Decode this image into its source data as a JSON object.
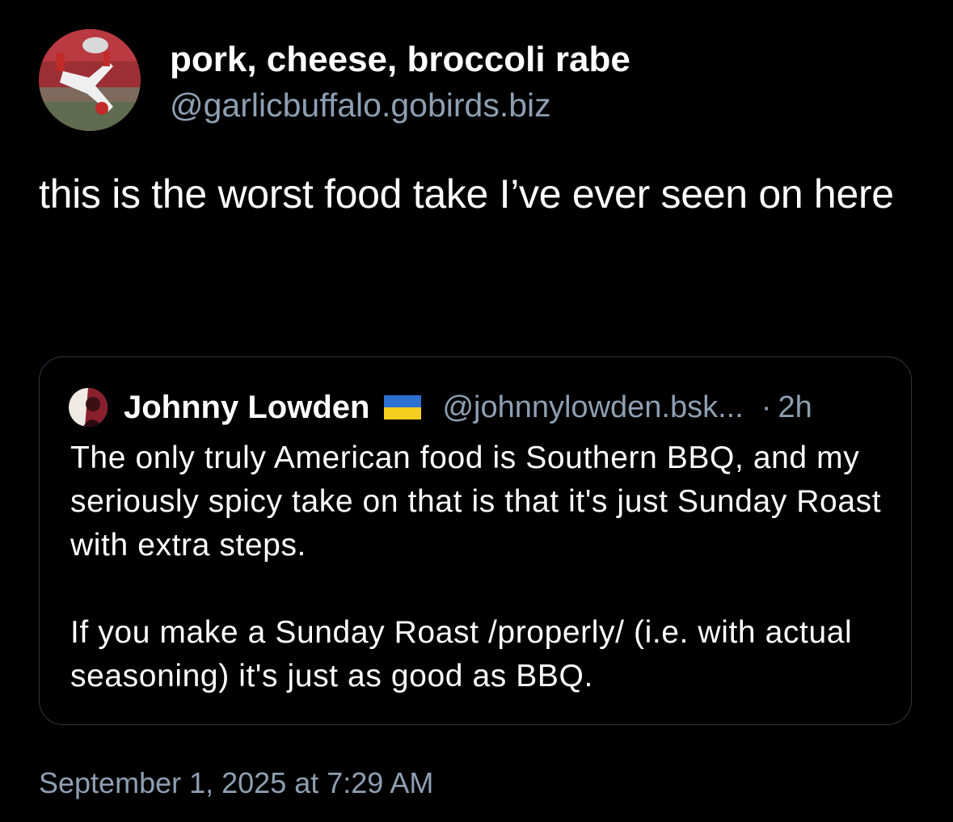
{
  "post": {
    "author": {
      "display_name": "pork, cheese, broccoli rabe",
      "handle": "@garlicbuffalo.gobirds.biz"
    },
    "text": "this is the worst food take I’ve ever seen on here",
    "timestamp": "September 1, 2025 at 7:29 AM"
  },
  "quote": {
    "author": {
      "display_name": "Johnny Lowden",
      "flag_icon": "ukraine-flag-icon",
      "handle": "@johnnylowden.bsk...",
      "separator": "·",
      "time_ago": "2h"
    },
    "paragraphs": [
      "The only truly American food is Southern BBQ, and my seriously spicy take on that is that it's just Sunday Roast with extra steps.",
      "If you make a Sunday Roast /properly/ (i.e. with actual seasoning) it's just as good as BBQ."
    ]
  },
  "colors": {
    "background": "#000000",
    "text": "#ffffff",
    "secondary_text": "#8e9fb3",
    "card_border": "#2f3740",
    "flag_blue": "#2e6fd2",
    "flag_yellow": "#f5cf1f"
  }
}
